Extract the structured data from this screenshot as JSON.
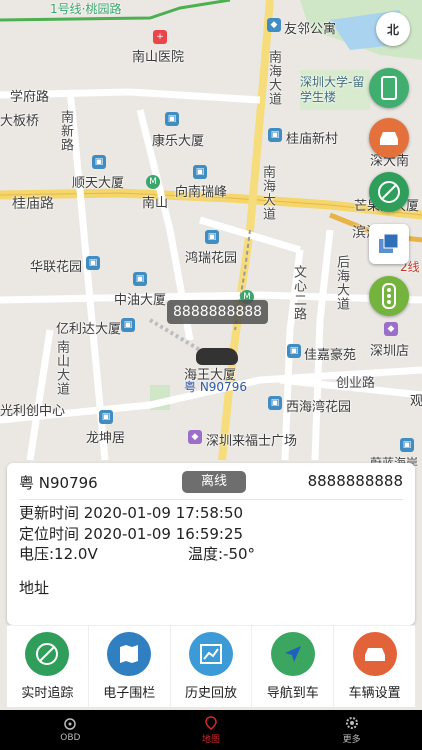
{
  "map": {
    "labels": {
      "metro_line1": "1号线·桃园路",
      "friend": "友邻公寓",
      "nanshan_hospital": "南山医院",
      "xuefu_road": "学府路",
      "da_xinban": "大板桥",
      "nanxin_road": "南新路",
      "kangle": "康乐大厦",
      "shenzhen_univ": "深圳大学-留学生楼",
      "nanhai_avenue": "南海大道",
      "guimiao_new": "桂庙新村",
      "shenda_south": "深大南",
      "shuntian": "顺天大厦",
      "nanshan": "南山",
      "xiangnan": "向南瑞峰",
      "guimiao_road": "桂庙路",
      "mangguo": "芒果网大厦",
      "binhai": "滨海",
      "hongrui": "鸿瑞花园",
      "hualian": "华联花园",
      "wenxin_road": "文心二路",
      "houhai": "后海大道",
      "zhongyou": "中油大厦",
      "yilida": "亿利达大厦",
      "shenzhen_store": "深圳店",
      "nanshan_avenue": "南山大道",
      "jiajia": "佳嘉豪苑",
      "haiwang": "海王大厦",
      "chuangye": "创业路",
      "guangli": "光利创中心",
      "xihai": "西海湾花园",
      "longkun": "龙坤居",
      "lai_fushi": "深圳来福士广场",
      "feiyang": "蔚蓝海岸",
      "guan": "观",
      "line2": "2线"
    },
    "vehicle_bubble": "8888888888",
    "vehicle_plate": "粤 N90796",
    "compass_label": "北"
  },
  "card": {
    "plate": "粤 N90796",
    "status": "离线",
    "device_id": "8888888888",
    "update_time": "更新时间 2020-01-09 17:58:50",
    "locate_time": "定位时间 2020-01-09 16:59:25",
    "voltage": "电压:12.0V",
    "temperature": "温度:-50°",
    "address_label": "地址"
  },
  "actions": [
    {
      "label": "实时追踪",
      "color": "#2f9e5b"
    },
    {
      "label": "电子围栏",
      "color": "#2f7fc1"
    },
    {
      "label": "历史回放",
      "color": "#3c9ad6"
    },
    {
      "label": "导航到车",
      "color": "#3aa65f"
    },
    {
      "label": "车辆设置",
      "color": "#e2633a"
    }
  ],
  "tabs": [
    {
      "label": "OBD"
    },
    {
      "label": "地图"
    },
    {
      "label": "更多"
    }
  ],
  "colors": {
    "accent": "#d8272d",
    "offline": "#6e6e6e"
  }
}
